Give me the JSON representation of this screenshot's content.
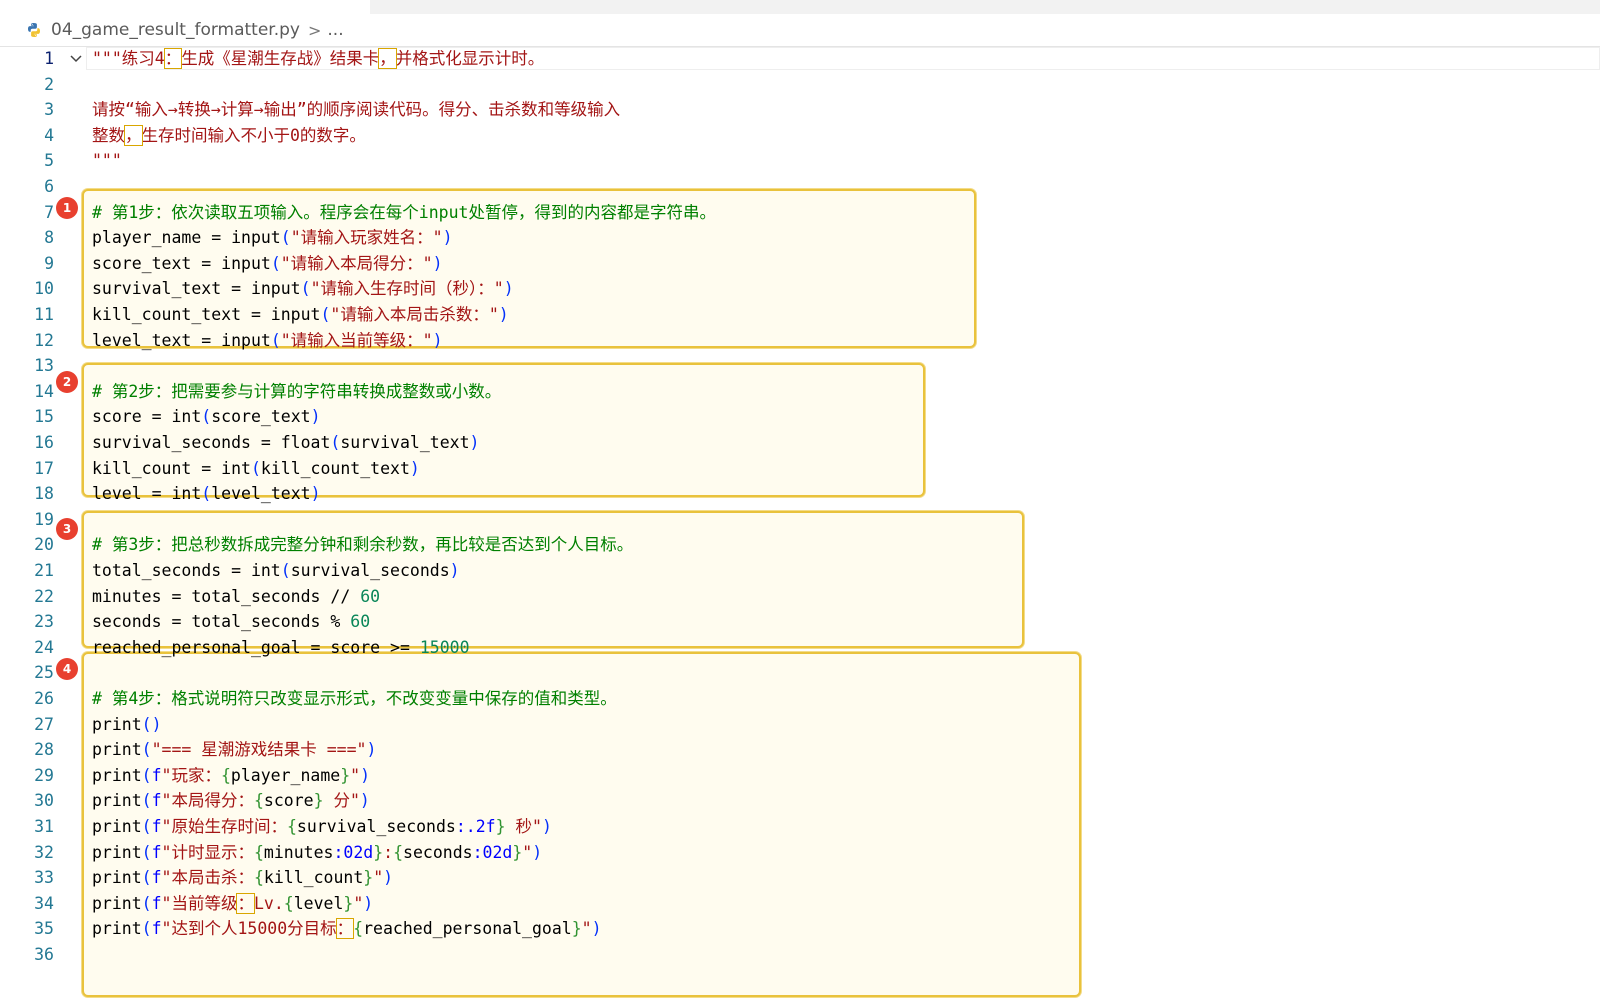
{
  "breadcrumb": {
    "file": "04_game_result_formatter.py",
    "separator": ">",
    "more": "..."
  },
  "badges": [
    "1",
    "2",
    "3",
    "4"
  ],
  "lines": [
    {
      "n": "1",
      "t": "\"\"\"练习4：生成《星潮生存战》结果卡，并格式化显示计时。"
    },
    {
      "n": "2",
      "t": ""
    },
    {
      "n": "3",
      "t": "请按“输入→转换→计算→输出”的顺序阅读代码。得分、击杀数和等级输入"
    },
    {
      "n": "4",
      "t": "整数，生存时间输入不小于0的数字。"
    },
    {
      "n": "5",
      "t": "\"\"\""
    },
    {
      "n": "6",
      "t": ""
    },
    {
      "n": "7",
      "t": "# 第1步：依次读取五项输入。程序会在每个input处暂停，得到的内容都是字符串。"
    },
    {
      "n": "8",
      "t": "player_name = input(\"请输入玩家姓名：\")"
    },
    {
      "n": "9",
      "t": "score_text = input(\"请输入本局得分：\")"
    },
    {
      "n": "10",
      "t": "survival_text = input(\"请输入生存时间（秒）：\")"
    },
    {
      "n": "11",
      "t": "kill_count_text = input(\"请输入本局击杀数：\")"
    },
    {
      "n": "12",
      "t": "level_text = input(\"请输入当前等级：\")"
    },
    {
      "n": "13",
      "t": ""
    },
    {
      "n": "14",
      "t": "# 第2步：把需要参与计算的字符串转换成整数或小数。"
    },
    {
      "n": "15",
      "t": "score = int(score_text)"
    },
    {
      "n": "16",
      "t": "survival_seconds = float(survival_text)"
    },
    {
      "n": "17",
      "t": "kill_count = int(kill_count_text)"
    },
    {
      "n": "18",
      "t": "level = int(level_text)"
    },
    {
      "n": "19",
      "t": ""
    },
    {
      "n": "20",
      "t": "# 第3步：把总秒数拆成完整分钟和剩余秒数，再比较是否达到个人目标。"
    },
    {
      "n": "21",
      "t": "total_seconds = int(survival_seconds)"
    },
    {
      "n": "22",
      "t": "minutes = total_seconds // 60"
    },
    {
      "n": "23",
      "t": "seconds = total_seconds % 60"
    },
    {
      "n": "24",
      "t": "reached_personal_goal = score >= 15000"
    },
    {
      "n": "25",
      "t": ""
    },
    {
      "n": "26",
      "t": "# 第4步：格式说明符只改变显示形式，不改变变量中保存的值和类型。"
    },
    {
      "n": "27",
      "t": "print()"
    },
    {
      "n": "28",
      "t": "print(\"=== 星潮游戏结果卡 ===\")"
    },
    {
      "n": "29",
      "t": "print(f\"玩家：{player_name}\")"
    },
    {
      "n": "30",
      "t": "print(f\"本局得分：{score} 分\")"
    },
    {
      "n": "31",
      "t": "print(f\"原始生存时间：{survival_seconds:.2f} 秒\")"
    },
    {
      "n": "32",
      "t": "print(f\"计时显示：{minutes:02d}:{seconds:02d}\")"
    },
    {
      "n": "33",
      "t": "print(f\"本局击杀：{kill_count}\")"
    },
    {
      "n": "34",
      "t": "print(f\"当前等级：Lv.{level}\")"
    },
    {
      "n": "35",
      "t": "print(f\"达到个人15000分目标：{reached_personal_goal}\")"
    },
    {
      "n": "36",
      "t": ""
    }
  ],
  "colors": {
    "string": "#a31515",
    "comment": "#008000",
    "number": "#098658",
    "bracket": "#0431fa",
    "region_border": "#e9c23c",
    "badge": "#e8402f"
  }
}
